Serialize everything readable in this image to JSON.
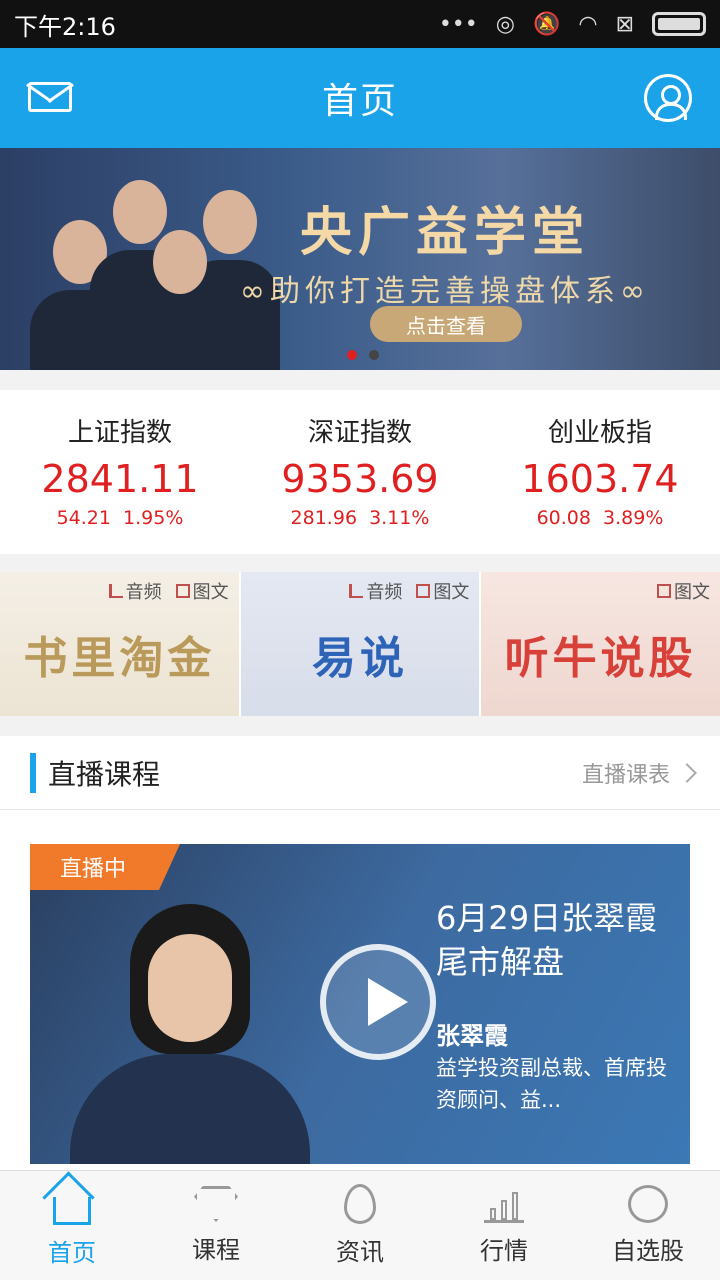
{
  "status": {
    "time": "下午2:16",
    "signal_dots": "•••"
  },
  "header": {
    "title": "首页"
  },
  "banner": {
    "title": "央广益学堂",
    "subtitle": "∞助你打造完善操盘体系∞",
    "button": "点击查看"
  },
  "indices": [
    {
      "name": "上证指数",
      "value": "2841.11",
      "change": "54.21",
      "pct": "1.95%"
    },
    {
      "name": "深证指数",
      "value": "9353.69",
      "change": "281.96",
      "pct": "3.11%"
    },
    {
      "name": "创业板指",
      "value": "1603.74",
      "change": "60.08",
      "pct": "3.89%"
    }
  ],
  "tiles": [
    {
      "name": "书里淘金",
      "tag_audio": "音频",
      "tag_text": "图文"
    },
    {
      "name": "易说",
      "tag_audio": "音频",
      "tag_text": "图文"
    },
    {
      "name": "听牛说股",
      "tag_text": "图文"
    }
  ],
  "live_section": {
    "title": "直播课程",
    "more": "直播课表"
  },
  "live_card": {
    "badge": "直播中",
    "title": "6月29日张翠霞尾市解盘",
    "host": "张翠霞",
    "desc": "益学投资副总裁、首席投资顾问、益..."
  },
  "tabbar": [
    {
      "label": "首页",
      "icon": "home-icon"
    },
    {
      "label": "课程",
      "icon": "diamond-icon"
    },
    {
      "label": "资讯",
      "icon": "flame-icon"
    },
    {
      "label": "行情",
      "icon": "bar-chart-icon"
    },
    {
      "label": "自选股",
      "icon": "coins-icon"
    }
  ],
  "colors": {
    "accent": "#1aa3e8",
    "up": "#e02020",
    "live_badge": "#f07a2a"
  }
}
